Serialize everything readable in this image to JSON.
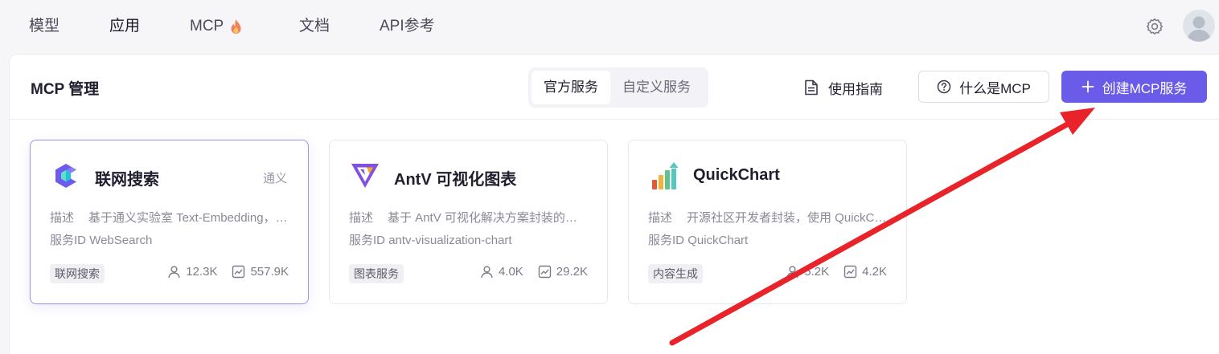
{
  "nav": {
    "items": [
      "模型",
      "应用",
      "MCP",
      "文档",
      "API参考"
    ],
    "active_index": 1
  },
  "header": {
    "title": "MCP 管理",
    "tabs": [
      "官方服务",
      "自定义服务"
    ],
    "active_tab": 0,
    "guide_label": "使用指南",
    "whatis_label": "什么是MCP",
    "create_label": "创建MCP服务"
  },
  "cards": [
    {
      "title": "联网搜索",
      "vendor": "通义",
      "desc_label": "描述",
      "desc": "基于通义实验室 Text-Embedding，GTE-reRank，Query 改写，搜索判定等多种检索模型…",
      "id_label": "服务ID",
      "id": "WebSearch",
      "tag": "联网搜索",
      "users": "12.3K",
      "calls": "557.9K"
    },
    {
      "title": "AntV 可视化图表",
      "vendor": "",
      "desc_label": "描述",
      "desc": "基于 AntV 可视化解决方案封装的…",
      "id_label": "服务ID",
      "id": "antv-visualization-chart",
      "tag": "图表服务",
      "users": "4.0K",
      "calls": "29.2K"
    },
    {
      "title": "QuickChart",
      "vendor": "",
      "desc_label": "描述",
      "desc": "开源社区开发者封装，使用 QuickC…",
      "id_label": "服务ID",
      "id": "QuickChart",
      "tag": "内容生成",
      "users": "5.2K",
      "calls": "4.2K"
    }
  ],
  "colors": {
    "accent": "#6a5be8",
    "annotation_arrow": "#e8232a"
  },
  "icons": {
    "fire": "fire-icon",
    "settings": "gear-icon",
    "guide": "document-icon",
    "help": "question-circle-icon",
    "plus": "plus-icon",
    "users": "user-icon",
    "calls": "trend-chart-icon"
  }
}
